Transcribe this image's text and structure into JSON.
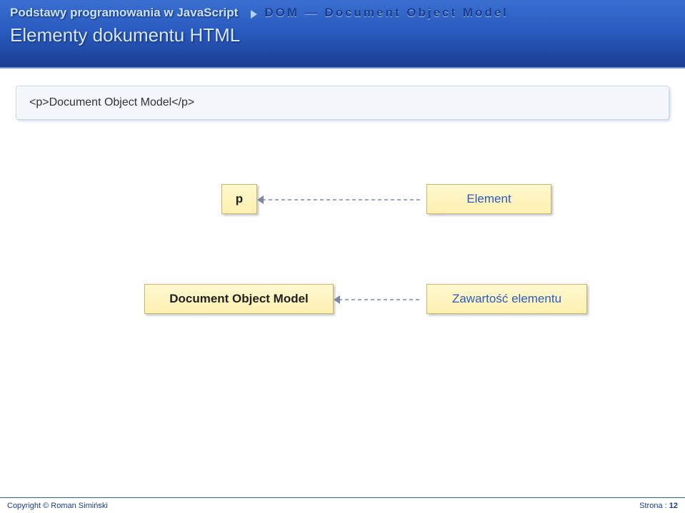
{
  "header": {
    "title_left": "Podstawy programowania w JavaScript",
    "title_right": "DOM — Document Object Model",
    "subtitle": "Elementy dokumentu HTML"
  },
  "code": "<p>Document Object Model</p>",
  "diagram": {
    "node_p": "p",
    "node_element": "Element",
    "node_dom": "Document Object Model",
    "node_content": "Zawartość elementu"
  },
  "footer": {
    "copyright": "Copyright © Roman Simiński",
    "page_label": "Strona :",
    "page_number": "12"
  }
}
